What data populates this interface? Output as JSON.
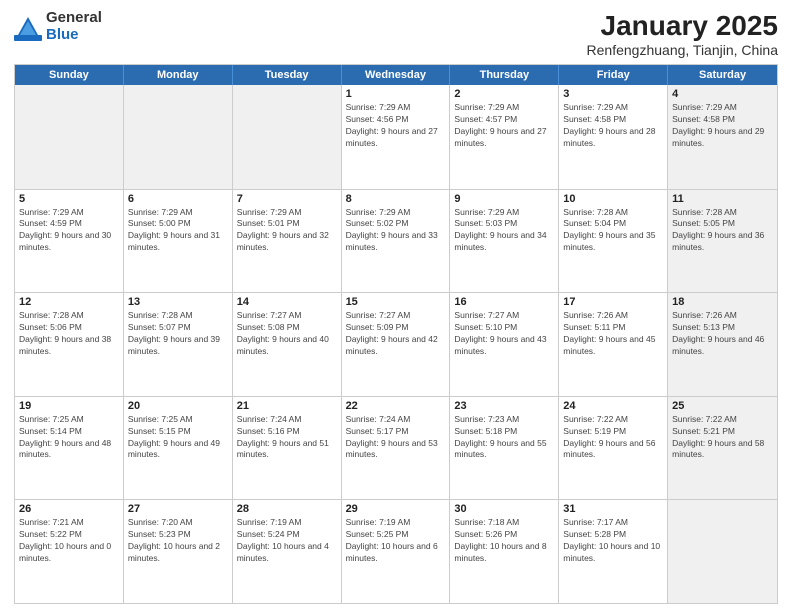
{
  "logo": {
    "general": "General",
    "blue": "Blue"
  },
  "title": {
    "month": "January 2025",
    "location": "Renfengzhuang, Tianjin, China"
  },
  "weekdays": [
    "Sunday",
    "Monday",
    "Tuesday",
    "Wednesday",
    "Thursday",
    "Friday",
    "Saturday"
  ],
  "weeks": [
    [
      {
        "day": "",
        "sunrise": "",
        "sunset": "",
        "daylight": "",
        "shaded": true
      },
      {
        "day": "",
        "sunrise": "",
        "sunset": "",
        "daylight": "",
        "shaded": true
      },
      {
        "day": "",
        "sunrise": "",
        "sunset": "",
        "daylight": "",
        "shaded": true
      },
      {
        "day": "1",
        "sunrise": "Sunrise: 7:29 AM",
        "sunset": "Sunset: 4:56 PM",
        "daylight": "Daylight: 9 hours and 27 minutes."
      },
      {
        "day": "2",
        "sunrise": "Sunrise: 7:29 AM",
        "sunset": "Sunset: 4:57 PM",
        "daylight": "Daylight: 9 hours and 27 minutes."
      },
      {
        "day": "3",
        "sunrise": "Sunrise: 7:29 AM",
        "sunset": "Sunset: 4:58 PM",
        "daylight": "Daylight: 9 hours and 28 minutes."
      },
      {
        "day": "4",
        "sunrise": "Sunrise: 7:29 AM",
        "sunset": "Sunset: 4:58 PM",
        "daylight": "Daylight: 9 hours and 29 minutes.",
        "shaded": true
      }
    ],
    [
      {
        "day": "5",
        "sunrise": "Sunrise: 7:29 AM",
        "sunset": "Sunset: 4:59 PM",
        "daylight": "Daylight: 9 hours and 30 minutes."
      },
      {
        "day": "6",
        "sunrise": "Sunrise: 7:29 AM",
        "sunset": "Sunset: 5:00 PM",
        "daylight": "Daylight: 9 hours and 31 minutes."
      },
      {
        "day": "7",
        "sunrise": "Sunrise: 7:29 AM",
        "sunset": "Sunset: 5:01 PM",
        "daylight": "Daylight: 9 hours and 32 minutes."
      },
      {
        "day": "8",
        "sunrise": "Sunrise: 7:29 AM",
        "sunset": "Sunset: 5:02 PM",
        "daylight": "Daylight: 9 hours and 33 minutes."
      },
      {
        "day": "9",
        "sunrise": "Sunrise: 7:29 AM",
        "sunset": "Sunset: 5:03 PM",
        "daylight": "Daylight: 9 hours and 34 minutes."
      },
      {
        "day": "10",
        "sunrise": "Sunrise: 7:28 AM",
        "sunset": "Sunset: 5:04 PM",
        "daylight": "Daylight: 9 hours and 35 minutes."
      },
      {
        "day": "11",
        "sunrise": "Sunrise: 7:28 AM",
        "sunset": "Sunset: 5:05 PM",
        "daylight": "Daylight: 9 hours and 36 minutes.",
        "shaded": true
      }
    ],
    [
      {
        "day": "12",
        "sunrise": "Sunrise: 7:28 AM",
        "sunset": "Sunset: 5:06 PM",
        "daylight": "Daylight: 9 hours and 38 minutes."
      },
      {
        "day": "13",
        "sunrise": "Sunrise: 7:28 AM",
        "sunset": "Sunset: 5:07 PM",
        "daylight": "Daylight: 9 hours and 39 minutes."
      },
      {
        "day": "14",
        "sunrise": "Sunrise: 7:27 AM",
        "sunset": "Sunset: 5:08 PM",
        "daylight": "Daylight: 9 hours and 40 minutes."
      },
      {
        "day": "15",
        "sunrise": "Sunrise: 7:27 AM",
        "sunset": "Sunset: 5:09 PM",
        "daylight": "Daylight: 9 hours and 42 minutes."
      },
      {
        "day": "16",
        "sunrise": "Sunrise: 7:27 AM",
        "sunset": "Sunset: 5:10 PM",
        "daylight": "Daylight: 9 hours and 43 minutes."
      },
      {
        "day": "17",
        "sunrise": "Sunrise: 7:26 AM",
        "sunset": "Sunset: 5:11 PM",
        "daylight": "Daylight: 9 hours and 45 minutes."
      },
      {
        "day": "18",
        "sunrise": "Sunrise: 7:26 AM",
        "sunset": "Sunset: 5:13 PM",
        "daylight": "Daylight: 9 hours and 46 minutes.",
        "shaded": true
      }
    ],
    [
      {
        "day": "19",
        "sunrise": "Sunrise: 7:25 AM",
        "sunset": "Sunset: 5:14 PM",
        "daylight": "Daylight: 9 hours and 48 minutes."
      },
      {
        "day": "20",
        "sunrise": "Sunrise: 7:25 AM",
        "sunset": "Sunset: 5:15 PM",
        "daylight": "Daylight: 9 hours and 49 minutes."
      },
      {
        "day": "21",
        "sunrise": "Sunrise: 7:24 AM",
        "sunset": "Sunset: 5:16 PM",
        "daylight": "Daylight: 9 hours and 51 minutes."
      },
      {
        "day": "22",
        "sunrise": "Sunrise: 7:24 AM",
        "sunset": "Sunset: 5:17 PM",
        "daylight": "Daylight: 9 hours and 53 minutes."
      },
      {
        "day": "23",
        "sunrise": "Sunrise: 7:23 AM",
        "sunset": "Sunset: 5:18 PM",
        "daylight": "Daylight: 9 hours and 55 minutes."
      },
      {
        "day": "24",
        "sunrise": "Sunrise: 7:22 AM",
        "sunset": "Sunset: 5:19 PM",
        "daylight": "Daylight: 9 hours and 56 minutes."
      },
      {
        "day": "25",
        "sunrise": "Sunrise: 7:22 AM",
        "sunset": "Sunset: 5:21 PM",
        "daylight": "Daylight: 9 hours and 58 minutes.",
        "shaded": true
      }
    ],
    [
      {
        "day": "26",
        "sunrise": "Sunrise: 7:21 AM",
        "sunset": "Sunset: 5:22 PM",
        "daylight": "Daylight: 10 hours and 0 minutes."
      },
      {
        "day": "27",
        "sunrise": "Sunrise: 7:20 AM",
        "sunset": "Sunset: 5:23 PM",
        "daylight": "Daylight: 10 hours and 2 minutes."
      },
      {
        "day": "28",
        "sunrise": "Sunrise: 7:19 AM",
        "sunset": "Sunset: 5:24 PM",
        "daylight": "Daylight: 10 hours and 4 minutes."
      },
      {
        "day": "29",
        "sunrise": "Sunrise: 7:19 AM",
        "sunset": "Sunset: 5:25 PM",
        "daylight": "Daylight: 10 hours and 6 minutes."
      },
      {
        "day": "30",
        "sunrise": "Sunrise: 7:18 AM",
        "sunset": "Sunset: 5:26 PM",
        "daylight": "Daylight: 10 hours and 8 minutes."
      },
      {
        "day": "31",
        "sunrise": "Sunrise: 7:17 AM",
        "sunset": "Sunset: 5:28 PM",
        "daylight": "Daylight: 10 hours and 10 minutes."
      },
      {
        "day": "",
        "sunrise": "",
        "sunset": "",
        "daylight": "",
        "shaded": true
      }
    ]
  ]
}
